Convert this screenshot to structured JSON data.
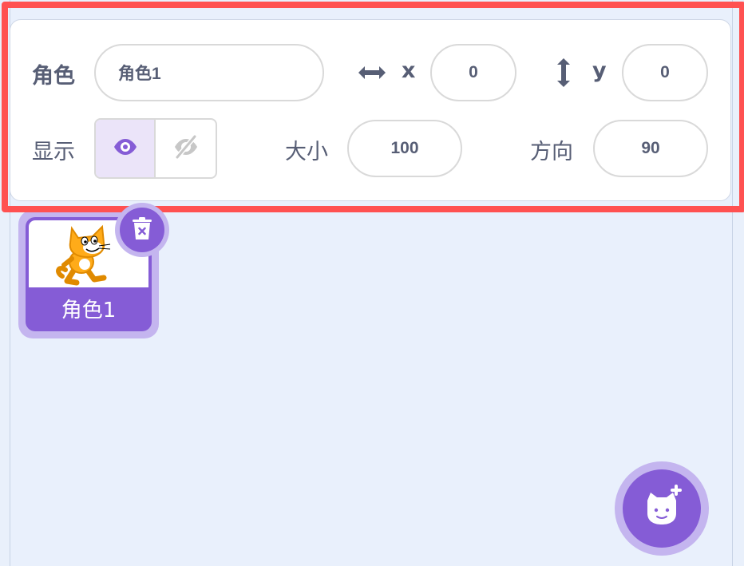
{
  "sprite_info": {
    "sprite_label": "角色",
    "sprite_name_value": "角色1",
    "x_label": "x",
    "x_value": "0",
    "y_label": "y",
    "y_value": "0",
    "show_label": "显示",
    "size_label": "大小",
    "size_value": "100",
    "direction_label": "方向",
    "direction_value": "90",
    "visible": true
  },
  "sprite_list": {
    "items": [
      {
        "name": "角色1",
        "selected": true
      }
    ]
  },
  "icons": {
    "x_arrow": "horizontal-arrows-icon",
    "y_arrow": "vertical-arrows-icon",
    "show": "eye-icon",
    "hide": "eye-slash-icon",
    "delete": "trash-icon",
    "add_sprite": "cat-plus-icon"
  },
  "colors": {
    "accent": "#855cd6",
    "accent_light": "#c4b5ef",
    "highlight": "#ff5151",
    "text": "#575e75",
    "background": "#e9f0fc"
  }
}
